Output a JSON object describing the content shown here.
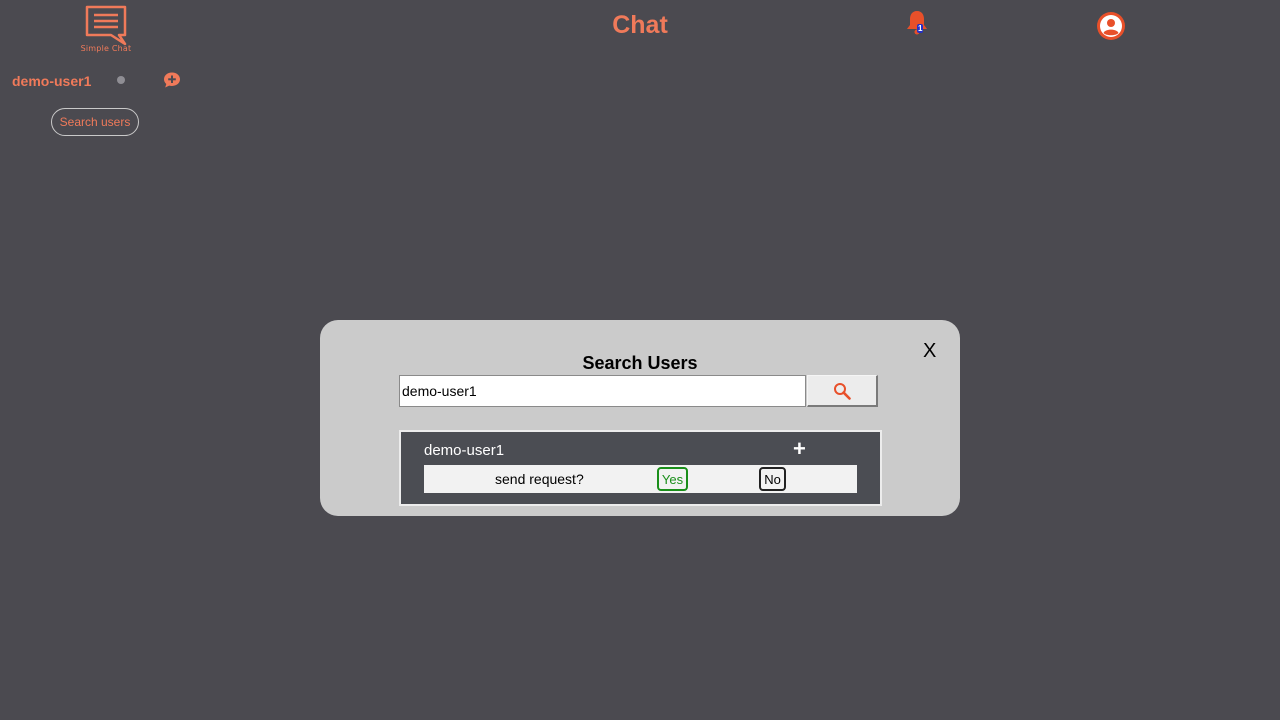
{
  "header": {
    "logo_text": "Simple Chat",
    "title": "Chat",
    "notification_badge": "1",
    "bell_icon": "bell-icon",
    "profile_icon": "user-circle-icon"
  },
  "sidebar": {
    "username": "demo-user1",
    "status_icon": "status-dot-icon",
    "new_chat_icon": "chat-plus-icon",
    "search_users_label": "Search users"
  },
  "modal": {
    "close_label": "X",
    "title": "Search Users",
    "search_value": "demo-user1",
    "search_icon": "search-icon",
    "results": [
      {
        "name": "demo-user1",
        "add_label": "+",
        "prompt": "send request?",
        "yes_label": "Yes",
        "no_label": "No"
      }
    ]
  },
  "colors": {
    "background": "#4b4a50",
    "accent": "#f07a5a",
    "modal_bg": "#cbcbcb",
    "result_bg": "#4b4d53",
    "yes": "#1a8f1a"
  }
}
